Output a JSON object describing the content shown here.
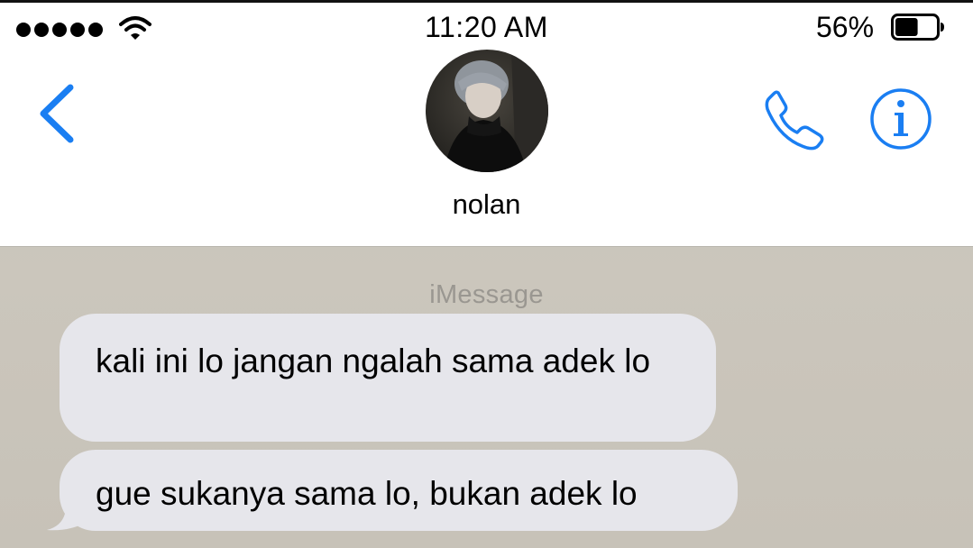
{
  "status_bar": {
    "time": "11:20 AM",
    "battery_percent": "56%",
    "battery_level": 0.56,
    "signal_bars": 5
  },
  "nav": {
    "back_icon": "chevron-left-icon",
    "contact_name": "nolan",
    "phone_icon": "phone-icon",
    "info_icon": "info-icon"
  },
  "chat": {
    "service_label": "iMessage",
    "messages": [
      {
        "text": "kali ini lo jangan ngalah sama adek lo",
        "direction": "incoming"
      },
      {
        "text": "gue sukanya sama lo, bukan adek lo",
        "direction": "incoming"
      }
    ]
  },
  "colors": {
    "accent": "#1a7ef2",
    "bubble_incoming": "#e6e6eb",
    "chat_background": "#c9c4ba",
    "service_label": "#9a9791"
  }
}
